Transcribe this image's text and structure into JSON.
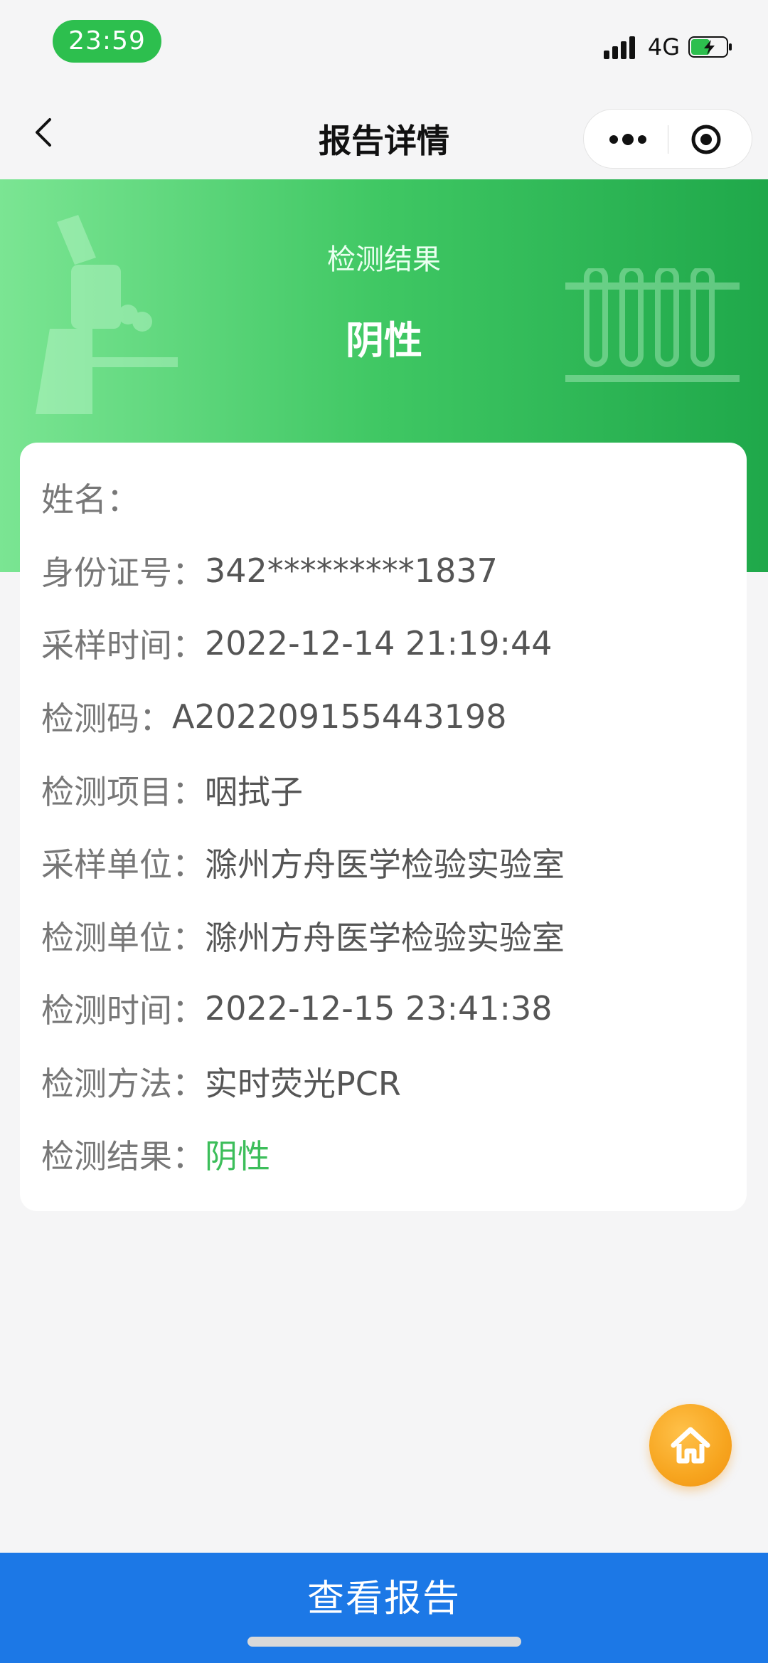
{
  "status_bar": {
    "time": "23:59",
    "network": "4G"
  },
  "nav": {
    "title": "报告详情"
  },
  "hero": {
    "label": "检测结果",
    "result": "阴性"
  },
  "details": [
    {
      "label": "姓名：",
      "value": ""
    },
    {
      "label": "身份证号：",
      "value": "342*********1837"
    },
    {
      "label": "采样时间：",
      "value": "2022-12-14 21:19:44"
    },
    {
      "label": "检测码：",
      "value": "A202209155443198"
    },
    {
      "label": "检测项目：",
      "value": "咽拭子"
    },
    {
      "label": "采样单位：",
      "value": "滁州方舟医学检验实验室"
    },
    {
      "label": "检测单位：",
      "value": "滁州方舟医学检验实验室"
    },
    {
      "label": "检测时间：",
      "value": "2022-12-15 23:41:38"
    },
    {
      "label": "检测方法：",
      "value": "实时荧光PCR"
    },
    {
      "label": "检测结果：",
      "value": "阴性"
    }
  ],
  "footer": {
    "button_label": "查看报告"
  },
  "colors": {
    "accent_green": "#3cbe5a",
    "primary_blue": "#1c78e6",
    "fab_orange": "#f7a51f"
  },
  "icons": [
    "back-icon",
    "more-icon",
    "target-icon",
    "microscope-icon",
    "test-tube-icon",
    "home-icon",
    "signal-icon",
    "battery-icon"
  ]
}
